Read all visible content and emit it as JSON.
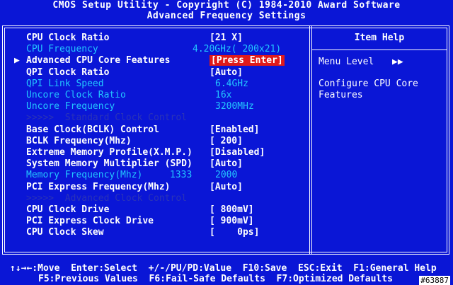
{
  "header": {
    "title": "CMOS Setup Utility - Copyright (C) 1984-2010 Award Software",
    "subtitle": "Advanced Frequency Settings"
  },
  "settings": [
    {
      "label": "CPU Clock Ratio",
      "value": "[21 X]",
      "style": "normal"
    },
    {
      "label": "CPU Frequency",
      "value": "4.20GHz( 200x21)",
      "style": "dim"
    },
    {
      "label": "Advanced CPU Core Features",
      "value": "[Press Enter]",
      "style": "selected",
      "marker": "▶"
    },
    {
      "label": "QPI Clock Ratio",
      "value": "[Auto]",
      "style": "normal"
    },
    {
      "label": "QPI Link Speed",
      "value": "6.4GHz",
      "style": "dim"
    },
    {
      "label": "Uncore Clock Ratio",
      "value": "16x",
      "style": "dim"
    },
    {
      "label": "Uncore Frequency",
      "value": "3200MHz",
      "style": "dim"
    },
    {
      "label": ">>>>>  Standard Clock Control",
      "value": "",
      "style": "grey"
    },
    {
      "label": "Base Clock(BCLK) Control",
      "value": "[Enabled]",
      "style": "normal"
    },
    {
      "label": "BCLK Frequency(Mhz)",
      "value": "[ 200]",
      "style": "normal"
    },
    {
      "label": "Extreme Memory Profile(X.M.P.)",
      "value": "[Disabled]",
      "style": "normal"
    },
    {
      "label": "System Memory Multiplier (SPD)",
      "value": "[Auto]",
      "style": "normal"
    },
    {
      "label": "Memory Frequency(Mhz)",
      "value": "2000",
      "extra": "1333",
      "style": "dim"
    },
    {
      "label": "PCI Express Frequency(Mhz)",
      "value": "[Auto]",
      "style": "normal"
    },
    {
      "label": ">>>>>  Advanced Clock Control",
      "value": "",
      "style": "grey"
    },
    {
      "label": "CPU Clock Drive",
      "value": "[ 800mV]",
      "style": "normal"
    },
    {
      "label": "PCI Express Clock Drive",
      "value": "[ 900mV]",
      "style": "normal"
    },
    {
      "label": "CPU Clock Skew",
      "value": "[    0ps]",
      "style": "normal"
    }
  ],
  "help": {
    "title": "Item Help",
    "menu_level_label": "Menu Level",
    "menu_level_arrow": "▶▶",
    "description": "Configure CPU Core\nFeatures"
  },
  "footer": {
    "line1": "↑↓→←:Move  Enter:Select  +/-/PU/PD:Value  F10:Save  ESC:Exit  F1:General Help",
    "line2": "F5:Previous Values  F6:Fail-Safe Defaults  F7:Optimized Defaults"
  },
  "watermark": "#63887",
  "colors": {
    "background": "#0a16d6",
    "text": "#ffffff",
    "dim_text": "#23c6ff",
    "grey_text": "#2a33b8",
    "highlight": "#e01a1a"
  }
}
